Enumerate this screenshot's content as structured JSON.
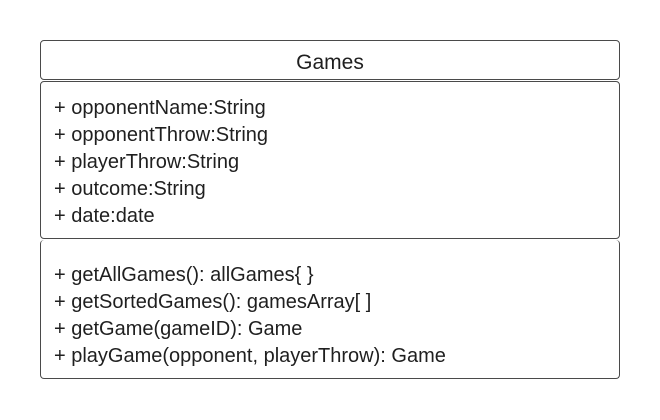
{
  "class": {
    "name": "Games",
    "attributes": [
      "+ opponentName:String",
      "+ opponentThrow:String",
      "+ playerThrow:String",
      "+ outcome:String",
      "+ date:date"
    ],
    "methods": [
      "+ getAllGames(): allGames{ }",
      "+ getSortedGames(): gamesArray[ ]",
      "+ getGame(gameID): Game",
      "+ playGame(opponent, playerThrow): Game"
    ]
  }
}
